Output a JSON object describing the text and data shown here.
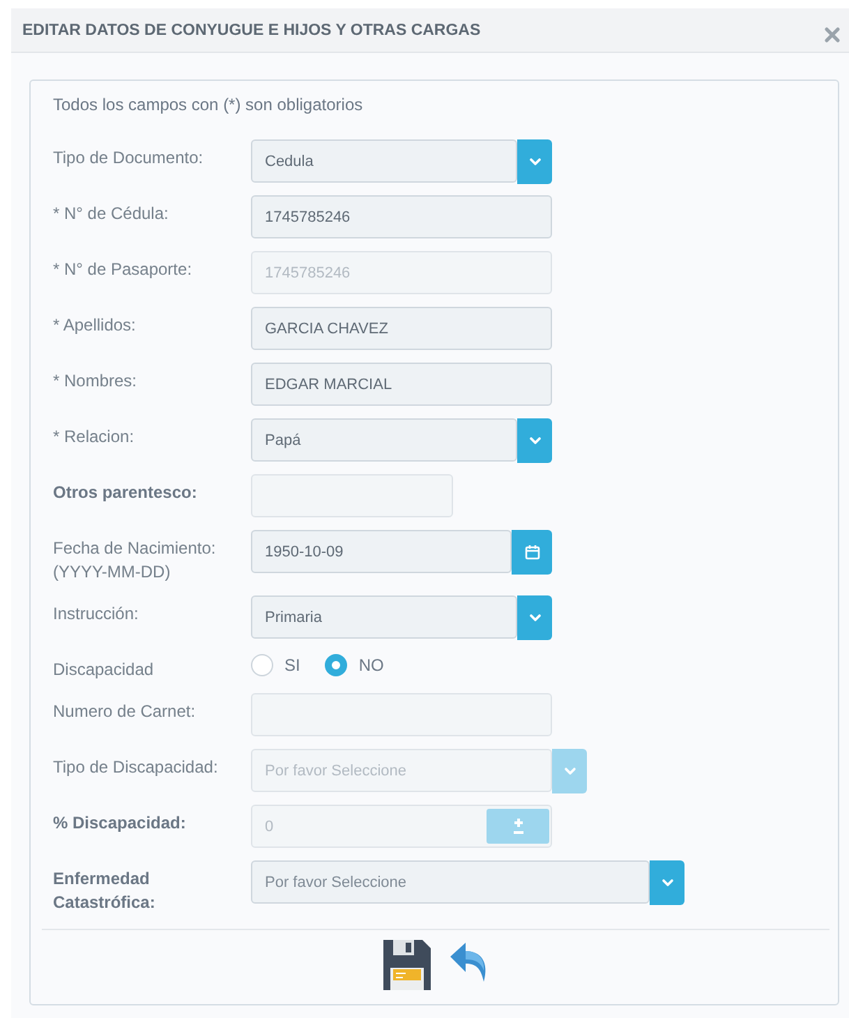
{
  "dialog": {
    "title": "EDITAR DATOS DE CONYUGUE E HIJOS Y OTRAS CARGAS",
    "note": "Todos los campos con (*) son obligatorios",
    "fields": [
      {
        "kind": "select",
        "label": "Tipo de Documento:",
        "bold": false,
        "value": "Cedula",
        "disabled": false
      },
      {
        "kind": "text",
        "label": "* N° de Cédula:",
        "bold": false,
        "value": "1745785246",
        "disabled": false
      },
      {
        "kind": "text",
        "label": "* N° de Pasaporte:",
        "bold": false,
        "value": "1745785246",
        "disabled": true
      },
      {
        "kind": "text",
        "label": "* Apellidos:",
        "bold": false,
        "value": "GARCIA CHAVEZ",
        "disabled": false
      },
      {
        "kind": "text",
        "label": "* Nombres:",
        "bold": false,
        "value": "EDGAR MARCIAL",
        "disabled": false
      },
      {
        "kind": "select",
        "label": "* Relacion:",
        "bold": false,
        "value": "Papá",
        "disabled": false
      },
      {
        "kind": "text",
        "label": "Otros parentesco:",
        "bold": true,
        "disabled": true
      },
      {
        "kind": "date",
        "label": "Fecha de Nacimiento:\n(YYYY-MM-DD)",
        "bold": false,
        "value": "1950-10-09",
        "disabled": false
      },
      {
        "kind": "select",
        "label": "Instrucción:",
        "bold": false,
        "value": "Primaria",
        "disabled": false
      },
      {
        "kind": "radio",
        "label": "Discapacidad",
        "bold": false,
        "options": [
          {
            "label": "SI",
            "selected": false
          },
          {
            "label": "NO",
            "selected": true
          }
        ]
      },
      {
        "kind": "text",
        "label": "Numero de Carnet:",
        "bold": false,
        "disabled": true
      },
      {
        "kind": "select",
        "label": "Tipo de Discapacidad:",
        "bold": false,
        "placeholder": "Por favor Seleccione",
        "disabled": true
      },
      {
        "kind": "number",
        "label": "% Discapacidad:",
        "bold": true,
        "value": "0",
        "disabled": true
      },
      {
        "kind": "select",
        "label": "Enfermedad\nCatastrófica:",
        "bold": true,
        "placeholder": "Por favor Seleccione",
        "disabled": false
      }
    ]
  }
}
